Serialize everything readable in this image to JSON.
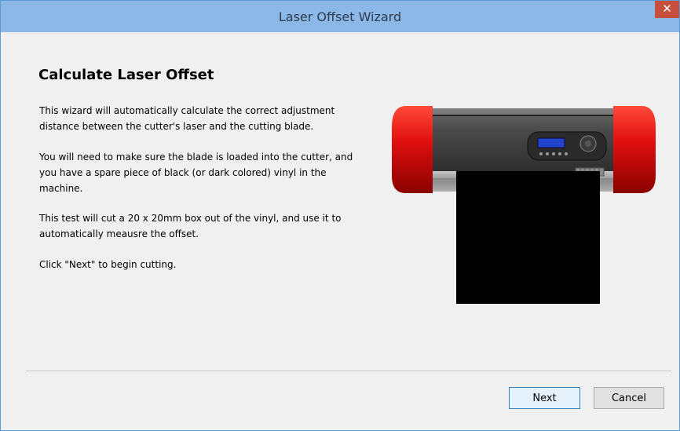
{
  "window": {
    "title": "Laser Offset Wizard",
    "close_glyph": "✕"
  },
  "content": {
    "heading": "Calculate Laser Offset",
    "paragraphs": [
      "This wizard will automatically calculate the correct adjustment distance between the cutter's laser and the cutting blade.",
      "You will need to make sure the blade is loaded into the cutter, and you have a spare piece of black (or dark colored) vinyl in the machine.",
      "This test will cut a 20 x 20mm box out of the vinyl, and use it to automatically meausre the offset.",
      "Click \"Next\" to begin cutting."
    ],
    "illustration": "vinyl-cutter-machine"
  },
  "buttons": {
    "next": "Next",
    "cancel": "Cancel"
  },
  "colors": {
    "titlebar": "#8cb8e8",
    "close": "#c74f3d",
    "accent_red": "#e01010",
    "vinyl": "#000000"
  }
}
